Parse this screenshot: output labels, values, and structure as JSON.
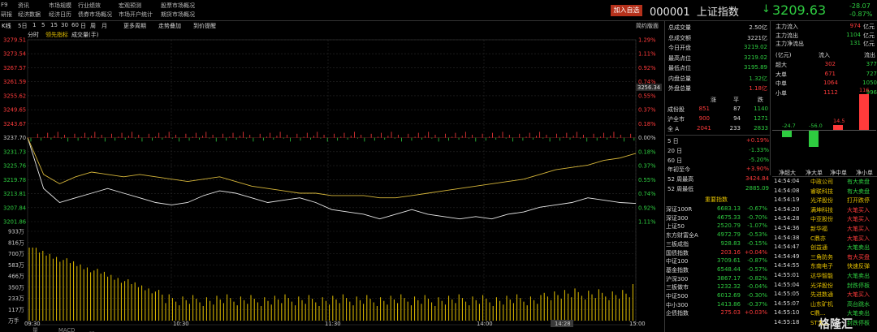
{
  "menu": {
    "row1": [
      "F9",
      "资讯",
      "市场规模",
      "行业绩效",
      "宏观预测",
      "股票市场概况"
    ],
    "row2": [
      "研报",
      "经济数据",
      "经济日历",
      "债券市场概况",
      "市场开户统计",
      "期货市场概况"
    ]
  },
  "header": {
    "watch": "加入自选",
    "code": "000001",
    "name": "上证指数",
    "price": "3209.63",
    "change": "-28.07",
    "pct": "-0.87%",
    "arrow": "↓"
  },
  "toolbar": {
    "items": [
      "K线",
      "5日",
      "1",
      "5",
      "15",
      "30",
      "60",
      "日",
      "周",
      "月",
      "更多周期",
      "走势叠加",
      "到价提醒"
    ],
    "right": "简约版面",
    "sub": [
      "分时",
      "领先指标",
      "成交量(手)"
    ]
  },
  "yaxis_left": [
    "3279.51",
    "3273.54",
    "3267.57",
    "3261.59",
    "3255.62",
    "3249.65",
    "3243.67",
    "3237.70",
    "3231.73",
    "3225.76",
    "3219.78",
    "3213.81",
    "3207.84",
    "3201.86"
  ],
  "yaxis_right": [
    "1.29%",
    "1.11%",
    "0.92%",
    "0.74%",
    "0.55%",
    "0.37%",
    "0.18%",
    "0.00%",
    "0.18%",
    "0.37%",
    "0.55%",
    "0.74%",
    "0.92%",
    "1.11%"
  ],
  "crosshair": "3256.34",
  "vol_axis": [
    "933万",
    "816万",
    "700万",
    "583万",
    "466万",
    "350万",
    "233万",
    "117万",
    "万手"
  ],
  "time_axis": [
    "09:30",
    "10:30",
    "11:30",
    "14:00",
    "14:28",
    "15:00"
  ],
  "footer_tabs": [
    "量",
    "MACD",
    "..."
  ],
  "stats_left": [
    {
      "k": "总成交量",
      "v": "2.50亿",
      "c": "white"
    },
    {
      "k": "总成交额",
      "v": "3221亿",
      "c": "white"
    },
    {
      "k": "今日开盘",
      "v": "3219.02",
      "c": "green"
    },
    {
      "k": "最高点位",
      "v": "3219.02",
      "c": "green"
    },
    {
      "k": "最低点位",
      "v": "3195.89",
      "c": "green"
    },
    {
      "k": "内盘总量",
      "v": "1.32亿",
      "c": "green"
    },
    {
      "k": "外盘总量",
      "v": "1.18亿",
      "c": "red"
    }
  ],
  "flow": {
    "title": [
      "主力流入",
      "主力流出",
      "主力净流出"
    ],
    "vals": [
      "974",
      "1104",
      "131"
    ],
    "unit": "亿元",
    "hdr": [
      "(亿元)",
      "流入",
      "流出"
    ],
    "rows": [
      {
        "k": "超大",
        "a": "302",
        "b": "377"
      },
      {
        "k": "大单",
        "a": "671",
        "b": "727"
      },
      {
        "k": "中单",
        "a": "1064",
        "b": "1050"
      },
      {
        "k": "小单",
        "a": "1112",
        "b": "996"
      }
    ]
  },
  "breadth": {
    "hdr": [
      "涨",
      "平",
      "跌"
    ],
    "rows": [
      {
        "k": "成份股",
        "a": "851",
        "b": "87",
        "c": "1140"
      },
      {
        "k": "沪全市",
        "a": "900",
        "b": "94",
        "c": "1271"
      },
      {
        "k": "全 A",
        "a": "2041",
        "b": "233",
        "c": "2833"
      }
    ]
  },
  "periods": [
    {
      "k": "5 日",
      "v": "+0.19%",
      "c": "red"
    },
    {
      "k": "20 日",
      "v": "-1.33%",
      "c": "green"
    },
    {
      "k": "60 日",
      "v": "-5.20%",
      "c": "green"
    },
    {
      "k": "年初至今",
      "v": "+3.90%",
      "c": "red"
    },
    {
      "k": "52 周最高",
      "v": "3424.84",
      "c": "red"
    },
    {
      "k": "52 周最低",
      "v": "2885.09",
      "c": "green"
    }
  ],
  "bars": {
    "labels": [
      "-24.7",
      "-56.0",
      "14.5",
      "116"
    ],
    "values": [
      -24.7,
      -56.0,
      14.5,
      116
    ],
    "cols": [
      "净超大",
      "净大单",
      "净中单",
      "净小单"
    ]
  },
  "index_title": "重要指数",
  "indices": [
    {
      "n": "深证100R",
      "v": "6683.13",
      "p": "-0.67%",
      "c": "green"
    },
    {
      "n": "深证300",
      "v": "4675.33",
      "p": "-0.70%",
      "c": "green"
    },
    {
      "n": "上证50",
      "v": "2520.79",
      "p": "-1.07%",
      "c": "green"
    },
    {
      "n": "东方财富全A",
      "v": "4972.79",
      "p": "-0.53%",
      "c": "green"
    },
    {
      "n": "三板成指",
      "v": "928.83",
      "p": "-0.15%",
      "c": "green"
    },
    {
      "n": "国债指数",
      "v": "203.16",
      "p": "+0.04%",
      "c": "red"
    },
    {
      "n": "中证100",
      "v": "3709.61",
      "p": "-0.87%",
      "c": "green"
    },
    {
      "n": "基金指数",
      "v": "6548.44",
      "p": "-0.57%",
      "c": "green"
    },
    {
      "n": "沪深300",
      "v": "3867.17",
      "p": "-0.82%",
      "c": "green"
    },
    {
      "n": "三板做市",
      "v": "1232.32",
      "p": "-0.04%",
      "c": "green"
    },
    {
      "n": "中证500",
      "v": "6012.69",
      "p": "-0.30%",
      "c": "green"
    },
    {
      "n": "中小300",
      "v": "1413.86",
      "p": "-0.37%",
      "c": "green"
    },
    {
      "n": "企债指数",
      "v": "275.03",
      "p": "+0.03%",
      "c": "red"
    }
  ],
  "events": [
    {
      "t": "14:54:04",
      "s": "中政公司",
      "e": "有大卖盘",
      "c": "green"
    },
    {
      "t": "14:54:08",
      "s": "睿联科技",
      "e": "有大卖盘",
      "c": "green"
    },
    {
      "t": "14:54:19",
      "s": "光洋股份",
      "e": "打开跌停",
      "c": "yellow"
    },
    {
      "t": "14:54:20",
      "s": "满坤科技",
      "e": "大笔买入",
      "c": "red"
    },
    {
      "t": "14:54:28",
      "s": "中亚股份",
      "e": "大笔买入",
      "c": "red"
    },
    {
      "t": "14:54:36",
      "s": "新华福",
      "e": "大笔买入",
      "c": "red"
    },
    {
      "t": "14:54:38",
      "s": "C鼎亦",
      "e": "大笔买入",
      "c": "red"
    },
    {
      "t": "14:54:47",
      "s": "创益通",
      "e": "大笔卖出",
      "c": "green"
    },
    {
      "t": "14:54:49",
      "s": "三角防务",
      "e": "有大买盘",
      "c": "red"
    },
    {
      "t": "14:54:55",
      "s": "东南电子",
      "e": "快速反弹",
      "c": "yellow"
    },
    {
      "t": "14:55:01",
      "s": "达华智能",
      "e": "大笔卖出",
      "c": "green"
    },
    {
      "t": "14:55:04",
      "s": "光洋股份",
      "e": "封跌停板",
      "c": "green"
    },
    {
      "t": "14:55:05",
      "s": "先进数通",
      "e": "大笔买入",
      "c": "red"
    },
    {
      "t": "14:55:07",
      "s": "山东矿机",
      "e": "高台跳水",
      "c": "green"
    },
    {
      "t": "14:55:10",
      "s": "C鼎...",
      "e": "大笔卖出",
      "c": "green"
    },
    {
      "t": "14:55:18",
      "s": "ST大...",
      "e": "封跌停板",
      "c": "green"
    }
  ],
  "watermark": "格隆汇",
  "chart_data": {
    "type": "line",
    "title": "",
    "series": [
      {
        "name": "",
        "color": "#e8e8e8",
        "values": [
          3237.7,
          3216,
          3210,
          3212,
          3214,
          3216,
          3214,
          3212,
          3210,
          3209,
          3210,
          3213,
          3215,
          3214,
          3212,
          3210,
          3211,
          3212,
          3210,
          3207,
          3206,
          3205,
          3203,
          3205,
          3207,
          3205,
          3204,
          3203,
          3204,
          3203,
          3205,
          3206,
          3208,
          3209,
          3210,
          3212,
          3211,
          3210,
          3209.63
        ]
      },
      {
        "name": "",
        "color": "#d6b63a",
        "values": [
          3237.7,
          3222,
          3218,
          3221,
          3223,
          3222,
          3221,
          3222,
          3221,
          3220,
          3219,
          3220,
          3221,
          3219,
          3217,
          3216,
          3215,
          3214,
          3214,
          3213,
          3213,
          3213,
          3212,
          3212,
          3213,
          3214,
          3215,
          3216,
          3217,
          3218,
          3219,
          3220,
          3222,
          3224,
          3225,
          3226,
          3228,
          3229,
          3231
        ]
      }
    ],
    "ylim": [
      3201.86,
      3279.51
    ],
    "prev_close": 3237.7,
    "volume": {
      "ylim": [
        0,
        933
      ],
      "unit": "万"
    }
  }
}
